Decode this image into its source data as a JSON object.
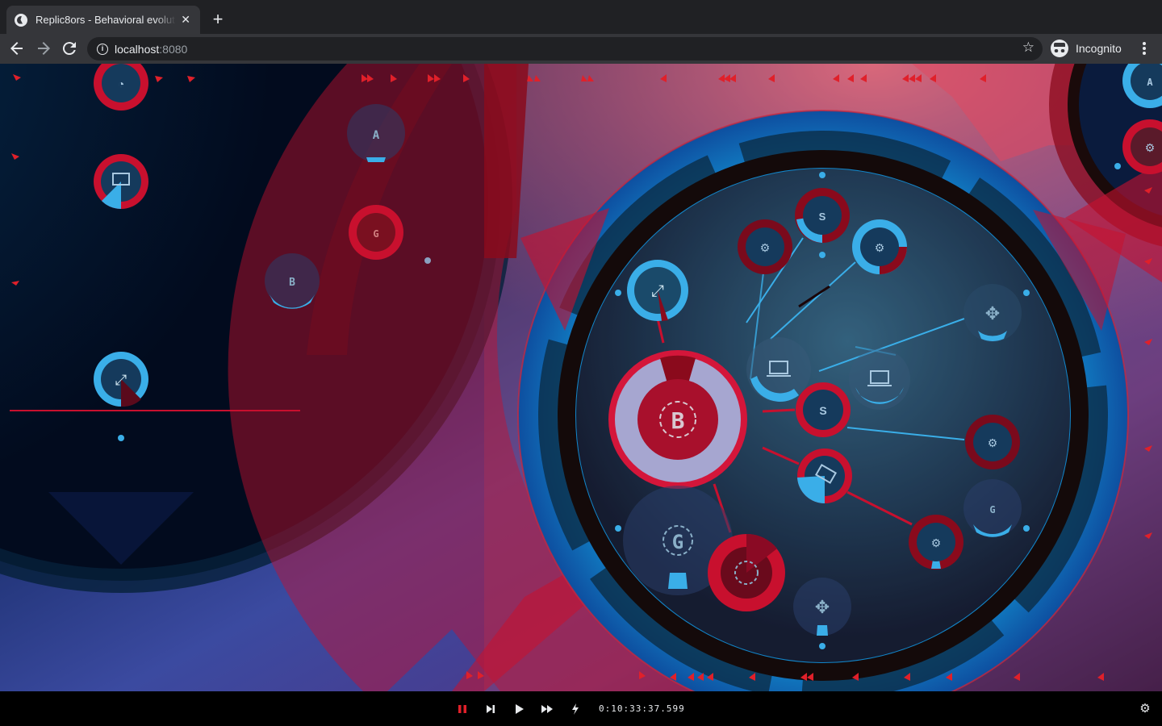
{
  "browser": {
    "tab_title": "Replic8ors - Behavioral evoluti",
    "tab_close": "✕",
    "new_tab": "+",
    "url_host": "localhost",
    "url_port": ":8080",
    "incognito_label": "Incognito"
  },
  "controls": {
    "clock": "0:10:33:37.599",
    "pause": "pause-icon",
    "step": "step-forward-icon",
    "play": "play-icon",
    "fast_forward": "fast-forward-icon",
    "turbo": "lightning-icon",
    "settings": "gear-icon"
  },
  "colors": {
    "accent_red": "#c8102e",
    "accent_blue": "#3aaee8",
    "pause_red": "#e0202a"
  }
}
